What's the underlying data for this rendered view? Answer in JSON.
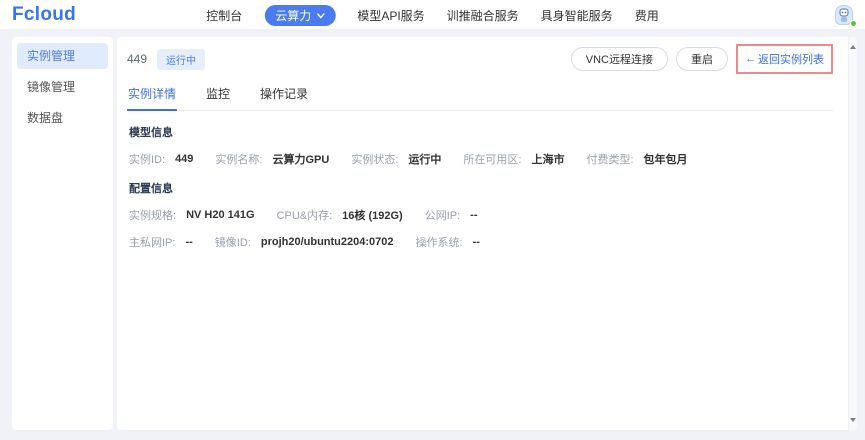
{
  "theme": {
    "accent": "#3b6ef0",
    "nav_pill_bg": "#4a7cf0",
    "badge_bg": "#e6eefc",
    "sidebar_active_bg": "#e1ebfe",
    "highlight_red": "#f08a8a",
    "status_green": "#5ec431",
    "page_bg": "#f0f2f7"
  },
  "header": {
    "logo": "Fcloud",
    "nav": [
      {
        "label": "控制台"
      },
      {
        "label": "云算力",
        "active": true
      },
      {
        "label": "模型API服务"
      },
      {
        "label": "训推融合服务"
      },
      {
        "label": "具身智能服务"
      },
      {
        "label": "费用"
      }
    ]
  },
  "sidebar": {
    "items": [
      {
        "label": "实例管理",
        "active": true
      },
      {
        "label": "镜像管理"
      },
      {
        "label": "数据盘"
      }
    ]
  },
  "main": {
    "instance_id": "449",
    "status_badge": "运行中",
    "actions": {
      "vnc": "VNC远程连接",
      "restart": "重启"
    },
    "back_link": {
      "arrow": "←",
      "label": "返回实例列表"
    },
    "tabs": [
      {
        "label": "实例详情",
        "active": true
      },
      {
        "label": "监控"
      },
      {
        "label": "操作记录"
      }
    ],
    "sections": [
      {
        "title": "模型信息",
        "rows": [
          [
            {
              "label": "实例ID:",
              "value": "449"
            },
            {
              "label": "实例名称:",
              "value": "云算力GPU"
            },
            {
              "label": "实例状态:",
              "value": "运行中"
            },
            {
              "label": "所在可用区:",
              "value": "上海市"
            },
            {
              "label": "付费类型:",
              "value": "包年包月"
            }
          ]
        ]
      },
      {
        "title": "配置信息",
        "rows": [
          [
            {
              "label": "实例规格:",
              "value": "NV H20 141G"
            },
            {
              "label": "CPU&内存:",
              "value": "16核 (192G)"
            },
            {
              "label": "公网IP:",
              "value": "--"
            }
          ],
          [
            {
              "label": "主私网IP:",
              "value": "--"
            },
            {
              "label": "镜像ID:",
              "value": "projh20/ubuntu2204:0702"
            },
            {
              "label": "操作系统:",
              "value": "--"
            }
          ]
        ]
      }
    ]
  }
}
